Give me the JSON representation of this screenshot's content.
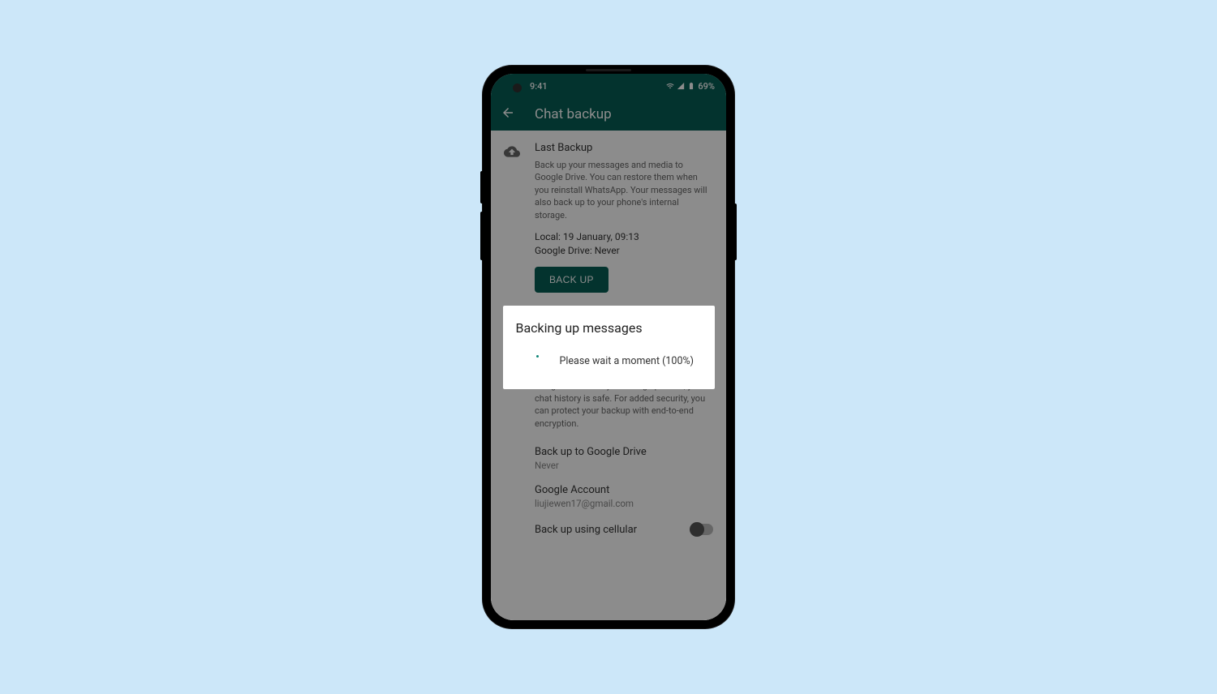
{
  "status": {
    "time": "9:41",
    "battery": "69%"
  },
  "appbar": {
    "title": "Chat backup"
  },
  "last_backup": {
    "title": "Last Backup",
    "desc": "Back up your messages and media to Google Drive. You can restore them when you reinstall WhatsApp. Your messages will also back up to your phone's internal storage.",
    "local": "Local: 19 January, 09:13",
    "gdrive": "Google Drive: Never",
    "button": "BACK UP"
  },
  "gdrive_settings": {
    "desc": "Back up your chat history and media to Google Drive so if you change phones, your chat history is safe. For added security, you can protect your backup with end-to-end encryption.",
    "freq_label": "Back up to Google Drive",
    "freq_value": "Never",
    "account_label": "Google Account",
    "account_value": "liujiewen17@gmail.com",
    "cellular_label": "Back up using cellular"
  },
  "dialog": {
    "title": "Backing up messages",
    "message": "Please wait a moment (100%)"
  }
}
